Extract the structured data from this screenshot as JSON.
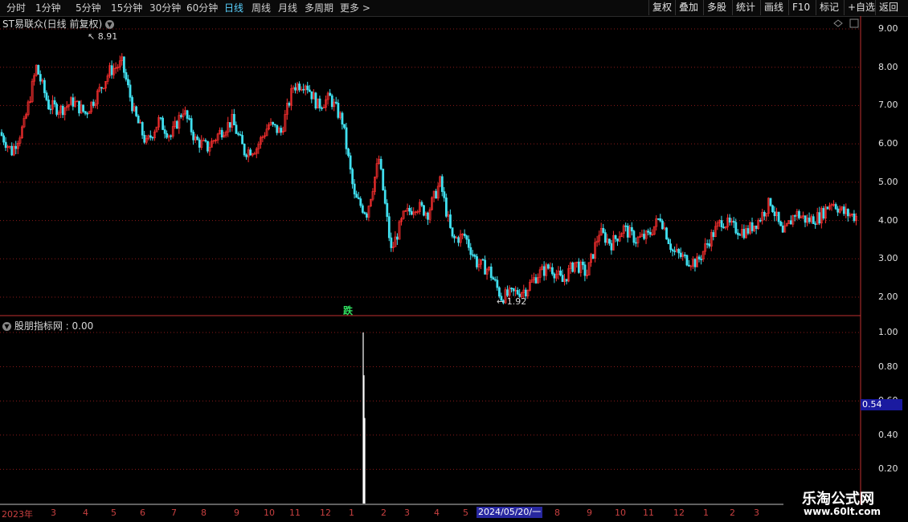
{
  "toolbar": {
    "tabs": [
      "分时",
      "1分钟",
      "5分钟",
      "15分钟",
      "30分钟",
      "60分钟",
      "日线",
      "周线",
      "月线",
      "多周期",
      "更多 >"
    ],
    "active_tab": "日线",
    "right_buttons": [
      "复权",
      "叠加",
      "多股",
      "统计",
      "画线",
      "F10",
      "标记",
      "+自选",
      "返回"
    ]
  },
  "main_chart": {
    "title": "ST易联众(日线 前复权)",
    "high_label": "8.91",
    "low_label": "1.92",
    "signal_text": "跌"
  },
  "indicator": {
    "title": "股朋指标网 : 0.00",
    "current_value": "0.54"
  },
  "watermark": {
    "line1": "乐淘公式网",
    "line2": "www.60lt.com"
  },
  "colors": {
    "up": "#ff3030",
    "down": "#40e0f0",
    "grid": "#8b1a1a",
    "accent": "#5ad2ff",
    "date_highlight": "#2828a0"
  },
  "chart_data": [
    {
      "type": "line",
      "name": "candlestick",
      "yticks": [
        "9.00",
        "8.00",
        "7.00",
        "6.00",
        "5.00",
        "4.00",
        "3.00",
        "2.00"
      ],
      "ylim": [
        1.7,
        9.2
      ],
      "xticks": [
        "2023年",
        "3",
        "4",
        "5",
        "6",
        "7",
        "8",
        "9",
        "10",
        "11",
        "12",
        "1",
        "2",
        "3",
        "4",
        "5",
        "2024/05/20/一",
        "8",
        "9",
        "10",
        "11",
        "12",
        "1",
        "2",
        "3"
      ],
      "x": [
        0,
        4,
        8,
        12,
        16,
        20,
        24,
        28,
        32,
        36,
        40,
        44,
        48,
        52,
        56,
        60,
        64,
        68,
        72,
        76,
        80,
        84,
        88,
        92,
        96,
        100,
        104,
        108,
        112,
        116,
        120,
        124,
        128,
        132,
        136,
        140,
        144,
        148,
        152,
        156,
        160,
        164,
        168,
        172,
        176,
        180,
        184,
        188,
        192,
        196,
        200,
        204,
        208,
        212,
        216,
        220,
        224,
        228,
        232,
        236,
        240,
        244,
        248,
        252,
        256,
        260,
        264,
        268,
        272,
        276,
        280
      ],
      "close": [
        6.3,
        5.8,
        6.5,
        8.0,
        7.0,
        6.9,
        7.1,
        6.8,
        7.3,
        7.9,
        8.1,
        6.8,
        6.0,
        6.6,
        6.2,
        6.9,
        6.1,
        5.9,
        6.3,
        6.6,
        5.8,
        5.9,
        6.5,
        6.3,
        7.5,
        7.6,
        7.0,
        7.2,
        6.6,
        4.6,
        4.2,
        5.6,
        3.2,
        4.1,
        4.4,
        4.2,
        5.0,
        3.5,
        3.6,
        2.9,
        2.7,
        2.0,
        2.1,
        2.2,
        2.6,
        2.8,
        2.4,
        2.9,
        2.6,
        3.7,
        3.4,
        3.8,
        3.5,
        3.6,
        4.1,
        3.2,
        3.0,
        2.9,
        3.5,
        4.0,
        3.8,
        3.7,
        4.0,
        4.5,
        3.6,
        4.2,
        4.0,
        4.1,
        4.5,
        4.2,
        4.1
      ]
    },
    {
      "type": "bar",
      "name": "股朋指标网",
      "yticks": [
        "1.00",
        "0.80",
        "0.60",
        "0.40",
        "0.20"
      ],
      "ylim": [
        0,
        1.05
      ],
      "values": [
        1.0,
        0.75,
        0.5
      ]
    }
  ]
}
